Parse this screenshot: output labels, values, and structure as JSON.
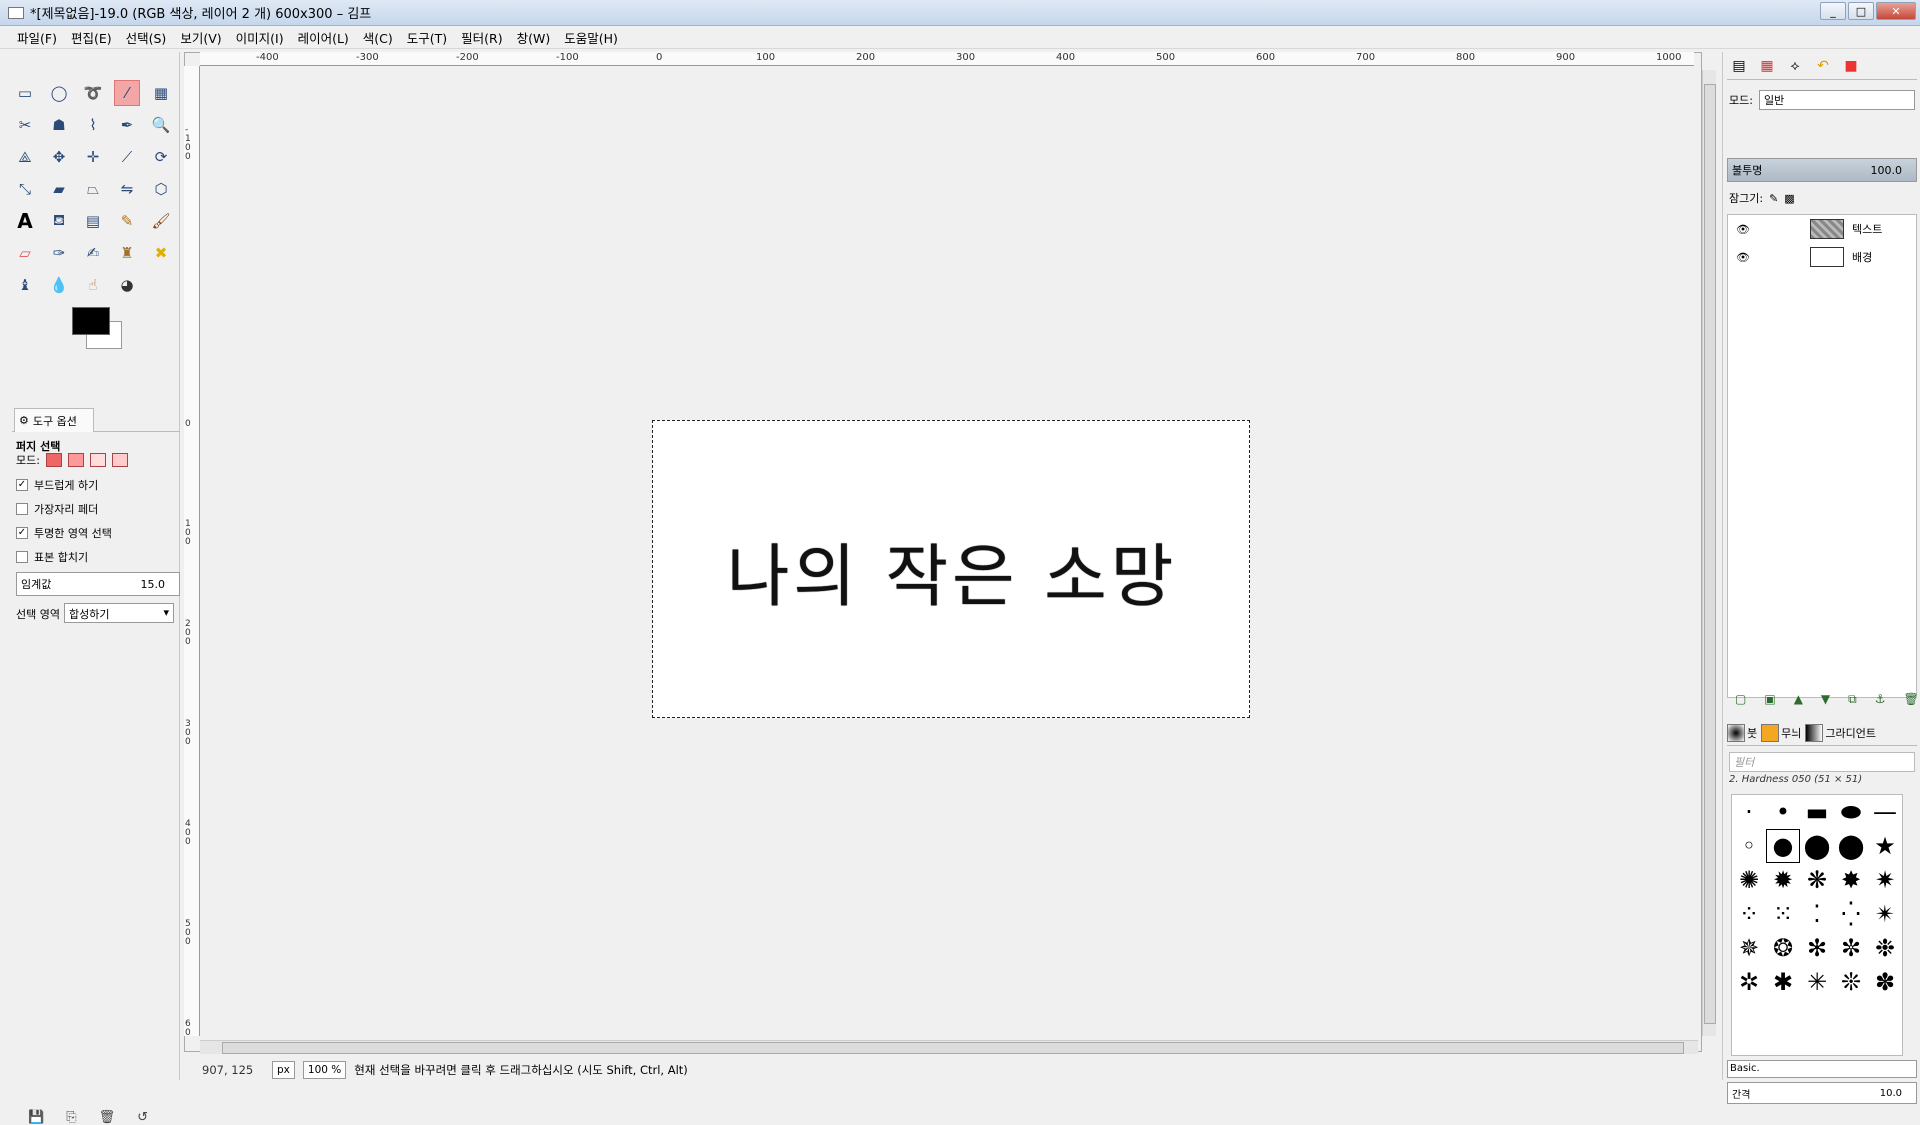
{
  "window": {
    "title": "*[제목없음]-19.0 (RGB 색상, 레이어 2 개) 600x300 – 김프",
    "min": "_",
    "max": "□",
    "close": "✕"
  },
  "menu": [
    "파일(F)",
    "편집(E)",
    "선택(S)",
    "보기(V)",
    "이미지(I)",
    "레이어(L)",
    "색(C)",
    "도구(T)",
    "필터(R)",
    "창(W)",
    "도움말(H)"
  ],
  "toolbox": {
    "tools": [
      "rect-select",
      "ellipse-select",
      "free-select",
      "fuzzy-select",
      "by-color-select",
      "scissors-select",
      "foreground-select",
      "paths",
      "color-picker",
      "zoom",
      "measure",
      "move",
      "align",
      "crop",
      "rotate",
      "scale",
      "shear",
      "perspective",
      "flip",
      "cage",
      "text",
      "bucket-fill",
      "blend",
      "pencil",
      "paintbrush",
      "eraser",
      "airbrush",
      "ink",
      "clone",
      "heal",
      "perspective-clone",
      "blur",
      "smudge",
      "dodge-burn"
    ],
    "active_tool": "fuzzy-select",
    "fg_color": "#000000",
    "bg_color": "#ffffff"
  },
  "tool_options": {
    "tab_label": "도구 옵션",
    "tool_name": "퍼지 선택",
    "mode_label": "모드:",
    "antialias": {
      "label": "부드럽게 하기",
      "checked": true
    },
    "feather": {
      "label": "가장자리 페더",
      "checked": false
    },
    "transparent": {
      "label": "투명한 영역 선택",
      "checked": true
    },
    "sample_merged": {
      "label": "표본 합치기",
      "checked": false
    },
    "threshold": {
      "label": "임계값",
      "value": "15.0"
    },
    "select_by": {
      "label": "선택 영역",
      "value": "합성하기"
    }
  },
  "rulers": {
    "h": [
      "-400",
      "-300",
      "-200",
      "-100",
      "0",
      "100",
      "200",
      "300",
      "400",
      "500",
      "600",
      "700",
      "800",
      "900",
      "1000"
    ],
    "v": [
      "-100",
      "0",
      "100",
      "200",
      "300",
      "400",
      "500",
      "600"
    ]
  },
  "canvas": {
    "text": "나의 작은 소망"
  },
  "status": {
    "coords": "907, 125",
    "unit": "px",
    "zoom": "100 %",
    "message": "현재 선택을 바꾸려면 클릭 후 드래그하십시오 (시도 Shift, Ctrl, Alt)"
  },
  "layers_panel": {
    "mode_label": "모드:",
    "mode_value": "일반",
    "opacity_label": "불투명",
    "opacity_value": "100.0",
    "lock_label": "잠그기:",
    "layers": [
      {
        "name": "텍스트"
      },
      {
        "name": "배경"
      }
    ]
  },
  "brushes_panel": {
    "tab_brushes": "붓",
    "tab_patterns": "무늬",
    "tab_gradients": "그라디언트",
    "filter_placeholder": "필터",
    "selected_brush": "2. Hardness 050 (51 × 51)",
    "preset": "Basic.",
    "spacing_label": "간격",
    "spacing_value": "10.0"
  }
}
